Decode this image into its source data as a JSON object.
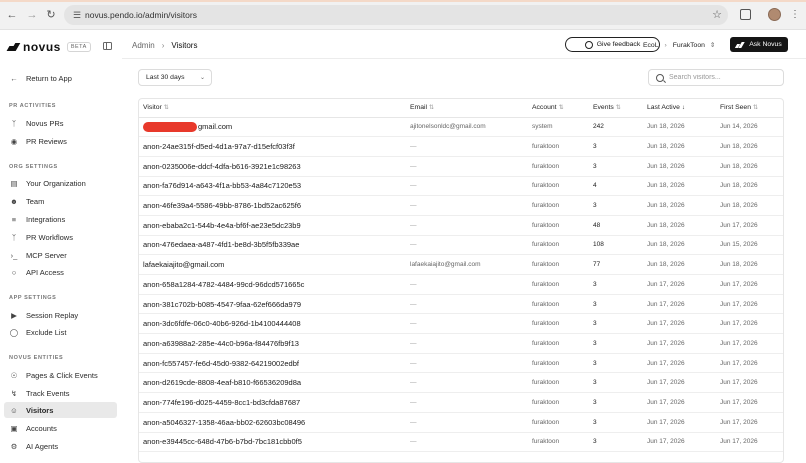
{
  "browser": {
    "url": "novus.pendo.io/admin/visitors"
  },
  "sidebar": {
    "logo": "novus",
    "beta": "BETA",
    "return_label": "Return to App",
    "sections": [
      {
        "label": "PR ACTIVITIES",
        "items": [
          {
            "label": "Novus PRs",
            "icon": "branch-icon"
          },
          {
            "label": "PR Reviews",
            "icon": "eye-icon"
          }
        ]
      },
      {
        "label": "ORG SETTINGS",
        "items": [
          {
            "label": "Your Organization",
            "icon": "building-icon"
          },
          {
            "label": "Team",
            "icon": "users-icon"
          },
          {
            "label": "Integrations",
            "icon": "sliders-icon"
          },
          {
            "label": "PR Workflows",
            "icon": "branch-icon"
          },
          {
            "label": "MCP Server",
            "icon": "terminal-icon"
          },
          {
            "label": "API Access",
            "icon": "key-icon"
          }
        ]
      },
      {
        "label": "APP SETTINGS",
        "items": [
          {
            "label": "Session Replay",
            "icon": "video-icon"
          },
          {
            "label": "Exclude List",
            "icon": "shield-icon"
          }
        ]
      },
      {
        "label": "NOVUS ENTITIES",
        "items": [
          {
            "label": "Pages & Click Events",
            "icon": "globe-icon"
          },
          {
            "label": "Track Events",
            "icon": "bolt-icon"
          },
          {
            "label": "Visitors",
            "icon": "user-icon",
            "active": true
          },
          {
            "label": "Accounts",
            "icon": "briefcase-icon"
          },
          {
            "label": "AI Agents",
            "icon": "bot-icon"
          }
        ]
      }
    ]
  },
  "header": {
    "breadcrumb_root": "Admin",
    "breadcrumb_current": "Visitors",
    "feedback_label": "Give feedback",
    "org_short": "EcoL",
    "org_name": "FurakToon",
    "ask_label": "Ask Novus"
  },
  "filters": {
    "date_range": "Last 30 days",
    "search_placeholder": "Search visitors..."
  },
  "table": {
    "columns": [
      "Visitor",
      "Email",
      "Account",
      "Events",
      "Last Active",
      "First Seen"
    ],
    "rows": [
      {
        "visitor": "gmail.com",
        "redacted_prefix": true,
        "email": "ajitonelsonldc@gmail.com",
        "account": "system",
        "events": "242",
        "last_active": "Jun 18, 2026",
        "first_seen": "Jun 14, 2026"
      },
      {
        "visitor": "anon-24ae315f-d5ed-4d1a-97a7-d15efcf03f3f",
        "email": "—",
        "account": "furaktoon",
        "events": "3",
        "last_active": "Jun 18, 2026",
        "first_seen": "Jun 18, 2026"
      },
      {
        "visitor": "anon-0235006e-ddcf-4dfa-b616-3921e1c98263",
        "email": "—",
        "account": "furaktoon",
        "events": "3",
        "last_active": "Jun 18, 2026",
        "first_seen": "Jun 18, 2026"
      },
      {
        "visitor": "anon-fa76d914-a643-4f1a-bb53-4a84c7120e53",
        "email": "—",
        "account": "furaktoon",
        "events": "4",
        "last_active": "Jun 18, 2026",
        "first_seen": "Jun 18, 2026"
      },
      {
        "visitor": "anon-46fe39a4-5586-49bb-8786-1bd52ac625f6",
        "email": "—",
        "account": "furaktoon",
        "events": "3",
        "last_active": "Jun 18, 2026",
        "first_seen": "Jun 18, 2026"
      },
      {
        "visitor": "anon-ebaba2c1-544b-4e4a-bf6f-ae23e5dc23b9",
        "email": "—",
        "account": "furaktoon",
        "events": "48",
        "last_active": "Jun 18, 2026",
        "first_seen": "Jun 17, 2026"
      },
      {
        "visitor": "anon-476edaea-a487-4fd1-be8d-3b5f5fb339ae",
        "email": "—",
        "account": "furaktoon",
        "events": "108",
        "last_active": "Jun 18, 2026",
        "first_seen": "Jun 15, 2026"
      },
      {
        "visitor": "lafaekaiajito@gmail.com",
        "email": "lafaekaiajito@gmail.com",
        "account": "furaktoon",
        "events": "77",
        "last_active": "Jun 18, 2026",
        "first_seen": "Jun 18, 2026"
      },
      {
        "visitor": "anon-658a1284-4782-4484-99cd-96dcd571665c",
        "email": "—",
        "account": "furaktoon",
        "events": "3",
        "last_active": "Jun 17, 2026",
        "first_seen": "Jun 17, 2026"
      },
      {
        "visitor": "anon-381c702b-b085-4547-9faa-62ef666da979",
        "email": "—",
        "account": "furaktoon",
        "events": "3",
        "last_active": "Jun 17, 2026",
        "first_seen": "Jun 17, 2026"
      },
      {
        "visitor": "anon-3dc6fdfe-06c0-40b6-926d-1b4100444408",
        "email": "—",
        "account": "furaktoon",
        "events": "3",
        "last_active": "Jun 17, 2026",
        "first_seen": "Jun 17, 2026"
      },
      {
        "visitor": "anon-a63988a2-285e-44c0-b96a-f84476fb9f13",
        "email": "—",
        "account": "furaktoon",
        "events": "3",
        "last_active": "Jun 17, 2026",
        "first_seen": "Jun 17, 2026"
      },
      {
        "visitor": "anon-fc557457-fe6d-45d0-9382-64219002edbf",
        "email": "—",
        "account": "furaktoon",
        "events": "3",
        "last_active": "Jun 17, 2026",
        "first_seen": "Jun 17, 2026"
      },
      {
        "visitor": "anon-d2619cde-8808-4eaf-b810-f66536209d8a",
        "email": "—",
        "account": "furaktoon",
        "events": "3",
        "last_active": "Jun 17, 2026",
        "first_seen": "Jun 17, 2026"
      },
      {
        "visitor": "anon-774fe196-d025-4459-8cc1-bd3cfda87687",
        "email": "—",
        "account": "furaktoon",
        "events": "3",
        "last_active": "Jun 17, 2026",
        "first_seen": "Jun 17, 2026"
      },
      {
        "visitor": "anon-a5046327-1358-46aa-bb02-62603bc08496",
        "email": "—",
        "account": "furaktoon",
        "events": "3",
        "last_active": "Jun 17, 2026",
        "first_seen": "Jun 17, 2026"
      },
      {
        "visitor": "anon-e39445cc-648d-47b6-b7bd-7bc181cbb0f5",
        "email": "—",
        "account": "furaktoon",
        "events": "3",
        "last_active": "Jun 17, 2026",
        "first_seen": "Jun 17, 2026"
      }
    ]
  }
}
